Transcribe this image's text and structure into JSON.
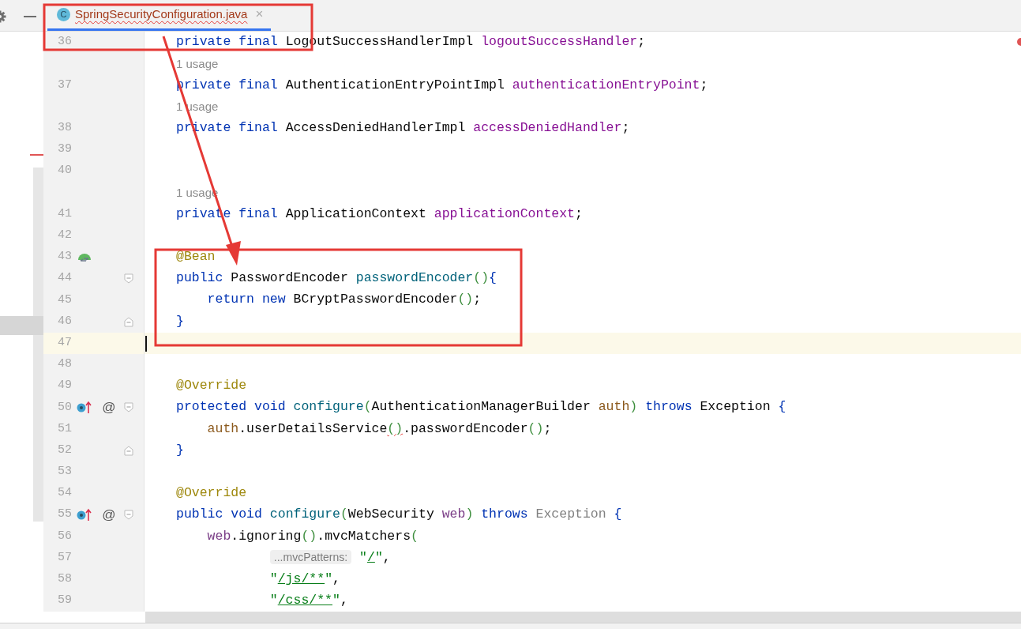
{
  "tabs": [
    {
      "icon_text": "C",
      "label": "SpringSecurityConfiguration.java",
      "close": "×",
      "selected": true,
      "error": true
    }
  ],
  "editor": {
    "rows": [
      {
        "kind": "code",
        "number": "36",
        "tokens": [
          {
            "text": "private final ",
            "kind": "kw"
          },
          {
            "text": "LogoutSuccessHandlerImpl ",
            "kind": "type"
          },
          {
            "text": "logoutSuccessHandler",
            "kind": "field"
          },
          {
            "text": ";",
            "kind": "plain"
          }
        ]
      },
      {
        "kind": "usage",
        "text": "1 usage"
      },
      {
        "kind": "code",
        "number": "37",
        "tokens": [
          {
            "text": "private final ",
            "kind": "kw"
          },
          {
            "text": "AuthenticationEntryPointImpl ",
            "kind": "type"
          },
          {
            "text": "authenticationEntryPoint",
            "kind": "field"
          },
          {
            "text": ";",
            "kind": "plain"
          }
        ]
      },
      {
        "kind": "usage",
        "text": "1 usage"
      },
      {
        "kind": "code",
        "number": "38",
        "tokens": [
          {
            "text": "private final ",
            "kind": "kw"
          },
          {
            "text": "AccessDeniedHandlerImpl ",
            "kind": "type"
          },
          {
            "text": "accessDeniedHandler",
            "kind": "field"
          },
          {
            "text": ";",
            "kind": "plain"
          }
        ]
      },
      {
        "kind": "code",
        "number": "39"
      },
      {
        "kind": "code",
        "number": "40"
      },
      {
        "kind": "usage",
        "text": "1 usage"
      },
      {
        "kind": "code",
        "number": "41",
        "tokens": [
          {
            "text": "private final ",
            "kind": "kw"
          },
          {
            "text": "ApplicationContext ",
            "kind": "type"
          },
          {
            "text": "applicationContext",
            "kind": "field"
          },
          {
            "text": ";",
            "kind": "plain"
          }
        ]
      },
      {
        "kind": "code",
        "number": "42"
      },
      {
        "kind": "code",
        "number": "43",
        "gutter": {
          "kind": "bean"
        },
        "tokens": [
          {
            "text": "@Bean",
            "kind": "ann"
          }
        ]
      },
      {
        "kind": "code",
        "number": "44",
        "fold": {
          "kind": "start"
        },
        "tokens": [
          {
            "text": "public ",
            "kind": "kw"
          },
          {
            "text": "PasswordEncoder ",
            "kind": "type"
          },
          {
            "text": "passwordEncoder",
            "kind": "method"
          },
          {
            "text": "()",
            "kind": "paren"
          },
          {
            "text": "{",
            "kind": "brace"
          }
        ],
        "children": [
          {
            "kind": "code",
            "number": "45",
            "tokens": [
              {
                "text": "return new ",
                "kind": "kw"
              },
              {
                "text": "BCryptPasswordEncoder",
                "kind": "type"
              },
              {
                "text": "()",
                "kind": "paren"
              },
              {
                "text": ";",
                "kind": "plain"
              }
            ]
          }
        ]
      },
      {
        "kind": "code",
        "number": "46",
        "fold": {
          "kind": "end"
        },
        "tokens": [
          {
            "text": "}",
            "kind": "brace"
          }
        ]
      },
      {
        "kind": "code",
        "number": "47",
        "current": true
      },
      {
        "kind": "code",
        "number": "48"
      },
      {
        "kind": "code",
        "number": "49",
        "tokens": [
          {
            "text": "@Override",
            "kind": "ann"
          }
        ]
      },
      {
        "kind": "code",
        "number": "50",
        "gutter": {
          "kind": "override"
        },
        "mark": "@",
        "fold": {
          "kind": "start"
        },
        "tokens": [
          {
            "text": "protected void ",
            "kind": "kw"
          },
          {
            "text": "configure",
            "kind": "method"
          },
          {
            "text": "(",
            "kind": "paren"
          },
          {
            "text": "AuthenticationManagerBuilder ",
            "kind": "type"
          },
          {
            "text": "auth",
            "kind": "param"
          },
          {
            "text": ") ",
            "kind": "paren"
          },
          {
            "text": "throws ",
            "kind": "kw"
          },
          {
            "text": "Exception ",
            "kind": "type"
          },
          {
            "text": "{",
            "kind": "brace"
          }
        ],
        "children": [
          {
            "kind": "code",
            "number": "51",
            "tokens": [
              {
                "text": "auth",
                "kind": "param"
              },
              {
                "text": ".userDetailsService",
                "kind": "plain"
              },
              {
                "text": "()",
                "kind": "paren",
                "error": true
              },
              {
                "text": ".passwordEncoder",
                "kind": "plain"
              },
              {
                "text": "()",
                "kind": "paren"
              },
              {
                "text": ";",
                "kind": "plain"
              }
            ]
          }
        ]
      },
      {
        "kind": "code",
        "number": "52",
        "fold": {
          "kind": "end"
        },
        "tokens": [
          {
            "text": "}",
            "kind": "brace"
          }
        ]
      },
      {
        "kind": "code",
        "number": "53"
      },
      {
        "kind": "code",
        "number": "54",
        "tokens": [
          {
            "text": "@Override",
            "kind": "ann"
          }
        ]
      },
      {
        "kind": "code",
        "number": "55",
        "gutter": {
          "kind": "override"
        },
        "mark": "@",
        "fold": {
          "kind": "start"
        },
        "tokens": [
          {
            "text": "public void ",
            "kind": "kw"
          },
          {
            "text": "configure",
            "kind": "method"
          },
          {
            "text": "(",
            "kind": "paren"
          },
          {
            "text": "WebSecurity ",
            "kind": "type"
          },
          {
            "text": "web",
            "kind": "local"
          },
          {
            "text": ") ",
            "kind": "paren"
          },
          {
            "text": "throws ",
            "kind": "kw"
          },
          {
            "text": "Exception ",
            "kind": "unused"
          },
          {
            "text": "{",
            "kind": "brace"
          }
        ],
        "children": [
          {
            "kind": "code",
            "number": "56",
            "tokens": [
              {
                "text": "web",
                "kind": "local"
              },
              {
                "text": ".ignoring",
                "kind": "plain"
              },
              {
                "text": "()",
                "kind": "paren"
              },
              {
                "text": ".mvcMatchers",
                "kind": "plain"
              },
              {
                "text": "(",
                "kind": "paren"
              }
            ],
            "children": [
              {
                "kind": "code",
                "number": "57",
                "tokens": [
                  {
                    "text": "...mvcPatterns:",
                    "kind": "hint"
                  },
                  {
                    "text": " \"",
                    "kind": "str"
                  },
                  {
                    "text": "/",
                    "kind": "str",
                    "link": true
                  },
                  {
                    "text": "\"",
                    "kind": "str"
                  },
                  {
                    "text": ",",
                    "kind": "plain"
                  }
                ]
              },
              {
                "kind": "code",
                "number": "58",
                "tokens": [
                  {
                    "text": "\"",
                    "kind": "str"
                  },
                  {
                    "text": "/js/**",
                    "kind": "str",
                    "link": true
                  },
                  {
                    "text": "\"",
                    "kind": "str"
                  },
                  {
                    "text": ",",
                    "kind": "plain"
                  }
                ]
              },
              {
                "kind": "code",
                "number": "59",
                "tokens": [
                  {
                    "text": "\"",
                    "kind": "str"
                  },
                  {
                    "text": "/css/**",
                    "kind": "str",
                    "link": true
                  },
                  {
                    "text": "\"",
                    "kind": "str"
                  },
                  {
                    "text": ",",
                    "kind": "plain"
                  }
                ]
              }
            ]
          }
        ]
      }
    ]
  }
}
